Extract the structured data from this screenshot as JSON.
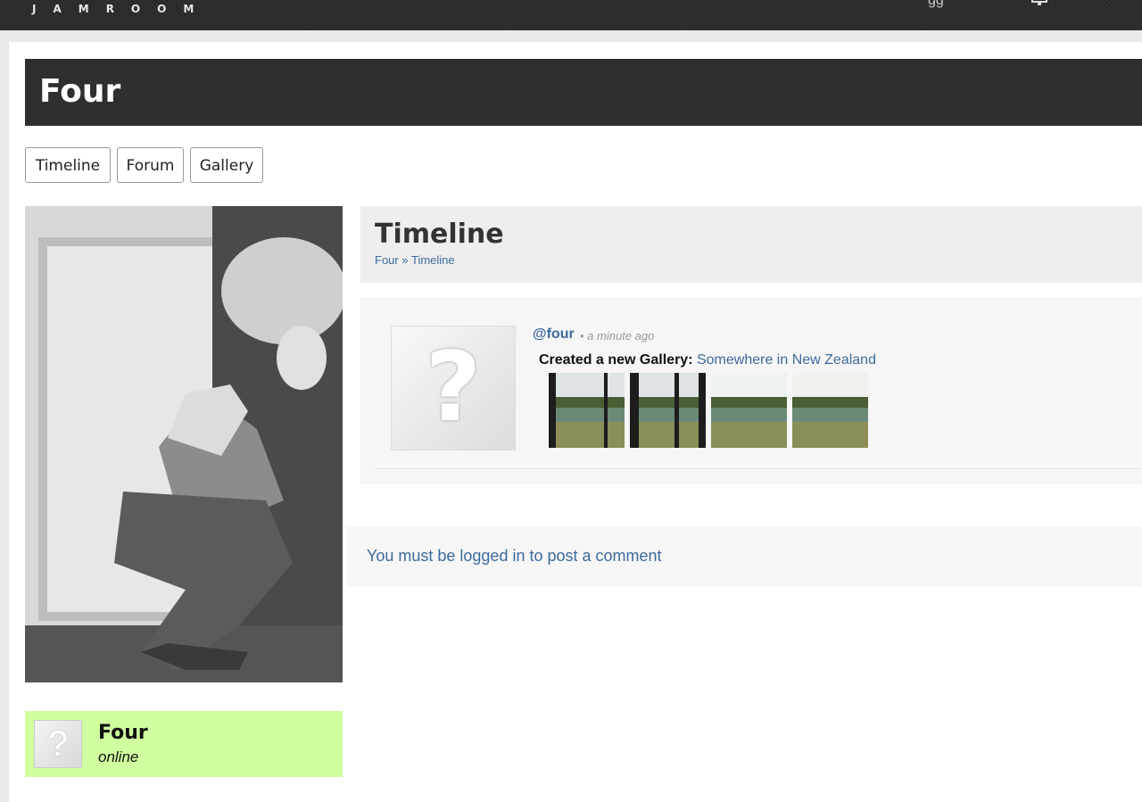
{
  "header": {
    "logo_text": "JAMROOM",
    "right_text": "gg"
  },
  "profile": {
    "title": "Four"
  },
  "tabs": [
    {
      "label": "Timeline"
    },
    {
      "label": "Forum"
    },
    {
      "label": "Gallery"
    }
  ],
  "timeline": {
    "title": "Timeline",
    "breadcrumb": {
      "profile": "Four",
      "separator": "»",
      "section": "Timeline"
    }
  },
  "entry": {
    "user": "@four",
    "time": "• a minute ago",
    "action": "Created a new Gallery:",
    "gallery_name": "Somewhere in New Zealand",
    "thumbnails": 4,
    "avatar_glyph": "?"
  },
  "comment": {
    "login_prompt": "You must be logged in to post a comment"
  },
  "online": {
    "name": "Four",
    "status": "online",
    "avatar_glyph": "?"
  },
  "colors": {
    "link": "#3d6a9c",
    "online_bg": "#cfff9f",
    "header_bg": "#2f2f2f"
  }
}
